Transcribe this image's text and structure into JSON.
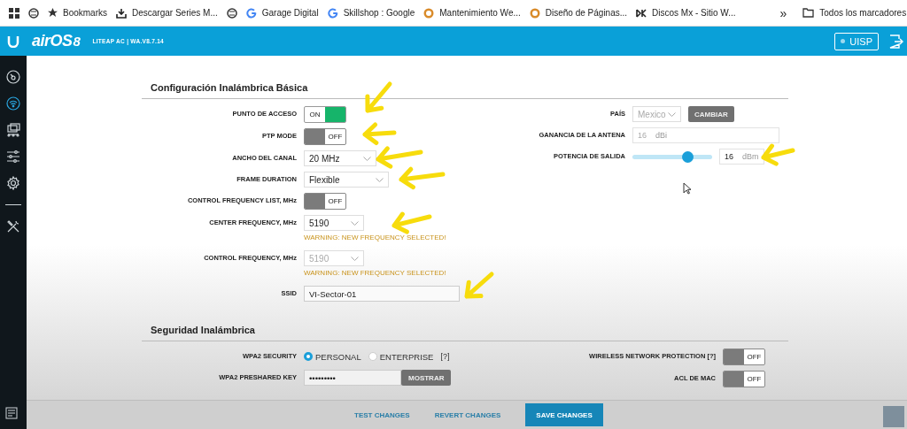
{
  "bookmarks_bar": {
    "items": [
      {
        "kind": "globe"
      },
      {
        "kind": "star",
        "label": "Bookmarks"
      },
      {
        "kind": "download",
        "label": "Descargar Series M..."
      },
      {
        "kind": "globe"
      },
      {
        "kind": "google",
        "label": "Garage Digital"
      },
      {
        "kind": "google",
        "label": "Skillshop : Google"
      },
      {
        "kind": "site",
        "label": "Mantenimiento We..."
      },
      {
        "kind": "site",
        "label": "Diseño de Páginas..."
      },
      {
        "kind": "dk",
        "label": "Discos Mx - Sitio W..."
      }
    ],
    "more": "»",
    "folder": "Todos los marcadores"
  },
  "header": {
    "logo": "airOS",
    "logo_version": "8",
    "device": "LITEAP AC | WA.V8.7.14",
    "uisp_button": "UISP"
  },
  "sidebar": {
    "items": [
      {
        "kind": "dashboard",
        "selected": false
      },
      {
        "kind": "wireless",
        "selected": true
      },
      {
        "kind": "network",
        "selected": false
      },
      {
        "kind": "services",
        "selected": false
      },
      {
        "kind": "system",
        "selected": false
      },
      {
        "kind": "tools",
        "selected": false
      }
    ]
  },
  "basic_wireless": {
    "title": "Configuración Inalámbrica Básica",
    "left": [
      {
        "kind": "toggle",
        "label": "PUNTO DE ACCESO",
        "on": true,
        "text": "ON"
      },
      {
        "kind": "toggle",
        "label": "PTP MODE",
        "on": false,
        "text": "OFF"
      },
      {
        "kind": "select",
        "label": "ANCHO DEL CANAL",
        "value": "20 MHz",
        "disabled": false
      },
      {
        "kind": "select",
        "label": "FRAME DURATION",
        "value": "Flexible",
        "disabled": false
      },
      {
        "kind": "toggle",
        "label": "CONTROL FREQUENCY LIST, MHz",
        "on": false,
        "text": "OFF"
      },
      {
        "kind": "select",
        "label": "CENTER FREQUENCY, MHz",
        "value": "5190",
        "disabled": false,
        "warning": "WARNING: NEW FREQUENCY SELECTED!"
      },
      {
        "kind": "select",
        "label": "CONTROL FREQUENCY, MHz",
        "value": "5190",
        "disabled": true,
        "warning": "WARNING: NEW FREQUENCY SELECTED!"
      },
      {
        "kind": "text",
        "label": "SSID",
        "value": "VI-Sector-01"
      }
    ],
    "right": [
      {
        "kind": "select_button",
        "label": "PAÍS",
        "value": "Mexico",
        "disabled": true,
        "button": "CAMBIAR"
      },
      {
        "kind": "input_unit",
        "label": "GANANCIA DE LA ANTENA",
        "value": "16",
        "unit": "dBi",
        "disabled": true
      },
      {
        "kind": "slider",
        "label": "POTENCIA DE SALIDA",
        "level": 0.69,
        "value": "16",
        "unit": "dBm"
      }
    ]
  },
  "wireless_security": {
    "title": "Seguridad Inalámbrica",
    "security_label": "WPA2 SECURITY",
    "options": [
      {
        "label": "PERSONAL",
        "selected": true
      },
      {
        "label": "ENTERPRISE",
        "selected": false
      }
    ],
    "help": "[?]",
    "key_label": "WPA2 PRESHARED KEY",
    "key_value": "•••••••••",
    "show_button": "MOSTRAR",
    "right": [
      {
        "label": "WIRELESS NETWORK PROTECTION [?]",
        "on": false,
        "text": "OFF"
      },
      {
        "label": "ACL DE MAC",
        "on": false,
        "text": "OFF"
      }
    ]
  },
  "footer": {
    "buttons": [
      {
        "label": "TEST CHANGES",
        "kind": "link"
      },
      {
        "label": "REVERT CHANGES",
        "kind": "link"
      },
      {
        "label": "SAVE CHANGES",
        "kind": "primary"
      }
    ]
  }
}
